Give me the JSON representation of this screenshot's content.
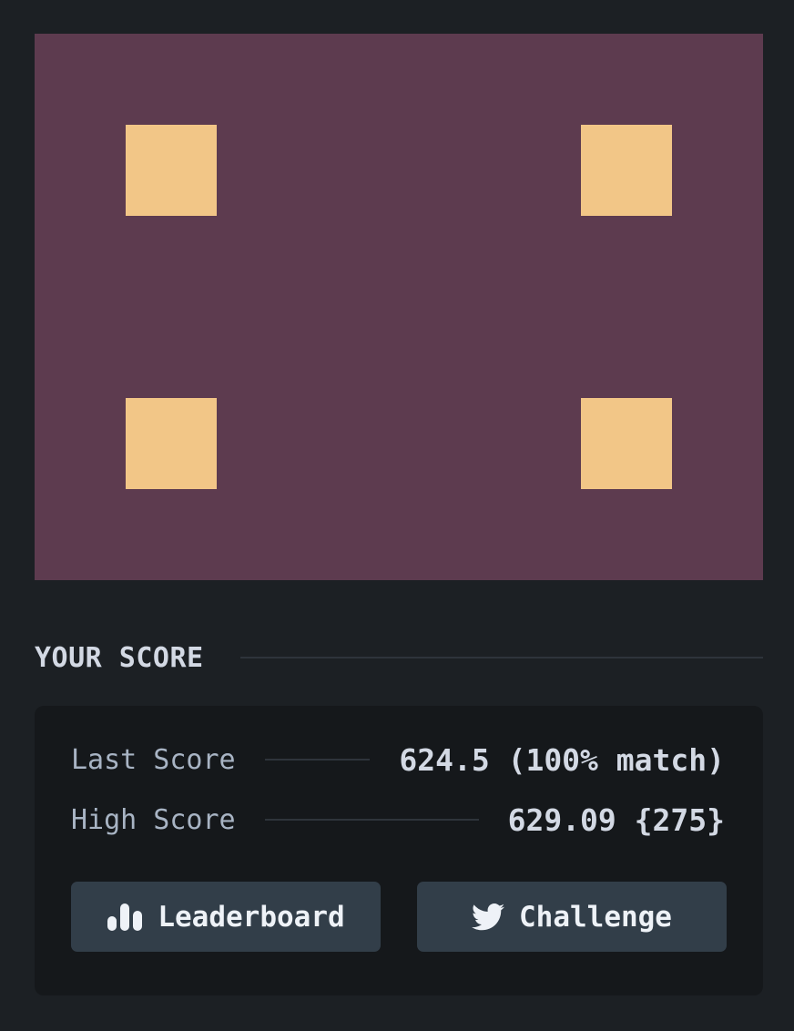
{
  "game": {
    "background_color": "#5d3b4f",
    "target_color": "#f2c687",
    "targets": [
      "target-top-left",
      "target-top-right",
      "target-bottom-left",
      "target-bottom-right"
    ]
  },
  "score_section": {
    "title": "YOUR SCORE"
  },
  "scores": {
    "last_label": "Last Score",
    "last_value": "624.5 (100% match)",
    "high_label": "High Score",
    "high_value": "629.09 {275}"
  },
  "buttons": {
    "leaderboard_label": "Leaderboard",
    "leaderboard_icon": "bar-chart-icon",
    "challenge_label": "Challenge",
    "challenge_icon": "twitter-icon"
  }
}
